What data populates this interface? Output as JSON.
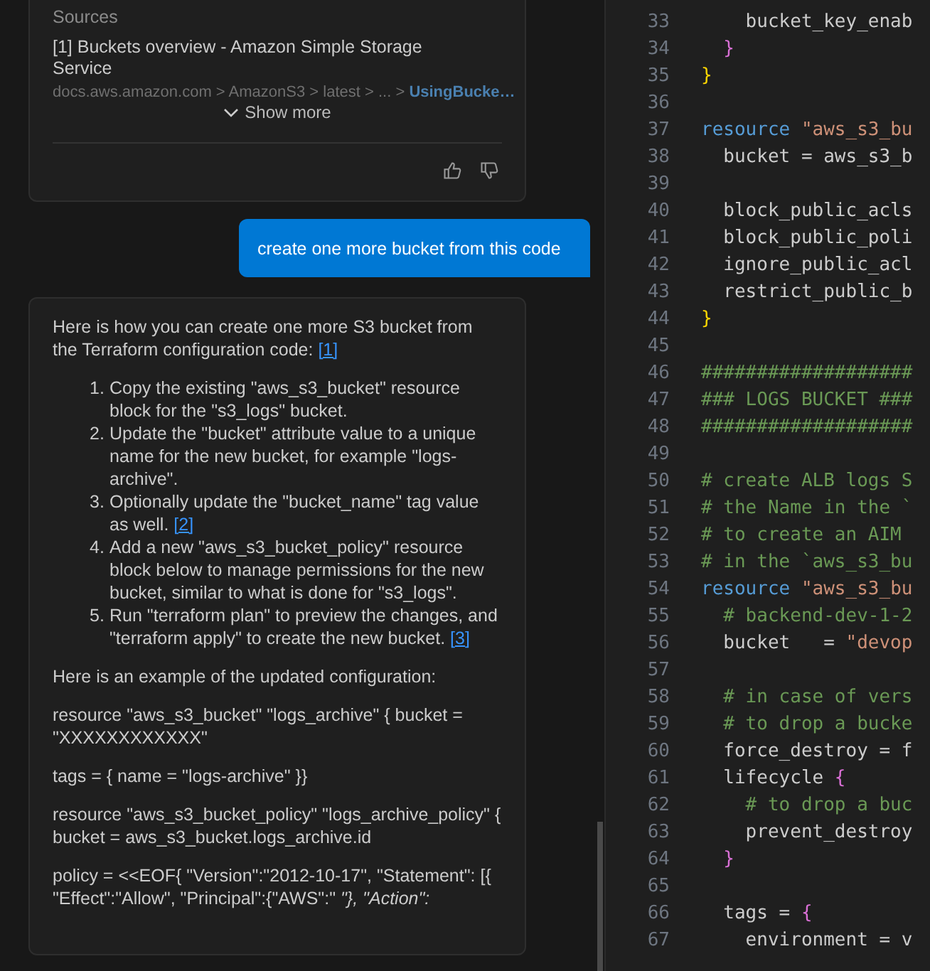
{
  "chat": {
    "sources_card": {
      "heading": "Sources",
      "source_title": "[1] Buckets overview - Amazon Simple Storage Service",
      "source_path": "docs.aws.amazon.com > AmazonS3 > latest > ... > ",
      "source_page": "UsingBucke…",
      "show_more": "Show more"
    },
    "user_message": "create one more bucket from this code",
    "answer": {
      "intro": {
        "text": "Here is how you can create one more S3 bucket from the Terraform configuration code: ",
        "ref": "[1]"
      },
      "steps": [
        {
          "number": "1.",
          "text": "Copy the existing \"aws_s3_bucket\" resource block for the \"s3_logs\" bucket."
        },
        {
          "number": "2.",
          "text": "Update the \"bucket\" attribute value to a unique name for the new bucket, for example \"logs-archive\"."
        },
        {
          "number": "3.",
          "text": "Optionally update the \"bucket_name\" tag value as well. ",
          "ref": "[2]"
        },
        {
          "number": "4.",
          "text": "Add a new \"aws_s3_bucket_policy\" resource block below to manage permissions for the new bucket, similar to what is done for \"s3_logs\"."
        },
        {
          "number": "5.",
          "text": "Run \"terraform plan\" to preview the changes, and \"terraform apply\" to create the new bucket. ",
          "ref": "[3]"
        }
      ],
      "paragraphs": [
        "Here is an example of the updated configuration:",
        "resource \"aws_s3_bucket\" \"logs_archive\" { bucket = \"XXXXXXXXXXXX\"",
        "tags = { name = \"logs-archive\" }}",
        "resource \"aws_s3_bucket_policy\" \"logs_archive_policy\" { bucket = aws_s3_bucket.logs_archive.id",
        "policy = <<EOF{ \"Version\":\"2012-10-17\", \"Statement\": [{ \"Effect\":\"Allow\", \"Principal\":{\"AWS\":\" *\"}, \"Action\":*"
      ]
    }
  },
  "editor": {
    "lines": [
      {
        "number": "33",
        "tokens": [
          {
            "kind": "plain",
            "text": "    bucket_key_enab"
          }
        ]
      },
      {
        "number": "34",
        "tokens": [
          {
            "kind": "brace2",
            "text": "  }"
          }
        ]
      },
      {
        "number": "35",
        "tokens": [
          {
            "kind": "brace1",
            "text": "}"
          }
        ]
      },
      {
        "number": "36"
      },
      {
        "number": "37",
        "tokens": [
          {
            "kind": "keyword",
            "text": "resource"
          },
          {
            "kind": "string",
            "text": " \"aws_s3_bu"
          }
        ]
      },
      {
        "number": "38",
        "tokens": [
          {
            "kind": "plain",
            "text": "  bucket = aws_s3_b"
          }
        ]
      },
      {
        "number": "39"
      },
      {
        "number": "40",
        "tokens": [
          {
            "kind": "plain",
            "text": "  block_public_acls"
          }
        ]
      },
      {
        "number": "41",
        "tokens": [
          {
            "kind": "plain",
            "text": "  block_public_poli"
          }
        ]
      },
      {
        "number": "42",
        "tokens": [
          {
            "kind": "plain",
            "text": "  ignore_public_acl"
          }
        ]
      },
      {
        "number": "43",
        "tokens": [
          {
            "kind": "plain",
            "text": "  restrict_public_b"
          }
        ]
      },
      {
        "number": "44",
        "tokens": [
          {
            "kind": "brace1",
            "text": "}"
          }
        ]
      },
      {
        "number": "45"
      },
      {
        "number": "46",
        "tokens": [
          {
            "kind": "comment",
            "text": "###################"
          }
        ]
      },
      {
        "number": "47",
        "tokens": [
          {
            "kind": "comment",
            "text": "### LOGS BUCKET ###"
          }
        ]
      },
      {
        "number": "48",
        "tokens": [
          {
            "kind": "comment",
            "text": "###################"
          }
        ]
      },
      {
        "number": "49"
      },
      {
        "number": "50",
        "tokens": [
          {
            "kind": "comment",
            "text": "# create ALB logs S"
          }
        ]
      },
      {
        "number": "51",
        "tokens": [
          {
            "kind": "comment",
            "text": "# the Name in the `"
          }
        ]
      },
      {
        "number": "52",
        "tokens": [
          {
            "kind": "comment",
            "text": "# to create an AIM"
          }
        ]
      },
      {
        "number": "53",
        "tokens": [
          {
            "kind": "comment",
            "text": "# in the `aws_s3_bu"
          }
        ]
      },
      {
        "number": "54",
        "tokens": [
          {
            "kind": "keyword",
            "text": "resource"
          },
          {
            "kind": "string",
            "text": " \"aws_s3_bu"
          }
        ]
      },
      {
        "number": "55",
        "tokens": [
          {
            "kind": "comment",
            "text": "  # backend-dev-1-2"
          }
        ]
      },
      {
        "number": "56",
        "tokens": [
          {
            "kind": "plain",
            "text": "  bucket   = "
          },
          {
            "kind": "string",
            "text": "\"devop"
          }
        ]
      },
      {
        "number": "57"
      },
      {
        "number": "58",
        "tokens": [
          {
            "kind": "comment",
            "text": "  # in case of vers"
          }
        ]
      },
      {
        "number": "59",
        "tokens": [
          {
            "kind": "comment",
            "text": "  # to drop a bucke"
          }
        ]
      },
      {
        "number": "60",
        "tokens": [
          {
            "kind": "plain",
            "text": "  force_destroy = f"
          }
        ]
      },
      {
        "number": "61",
        "tokens": [
          {
            "kind": "plain",
            "text": "  lifecycle "
          },
          {
            "kind": "brace2",
            "text": "{"
          }
        ]
      },
      {
        "number": "62",
        "tokens": [
          {
            "kind": "comment",
            "text": "    # to drop a buc"
          }
        ]
      },
      {
        "number": "63",
        "tokens": [
          {
            "kind": "plain",
            "text": "    prevent_destroy"
          }
        ]
      },
      {
        "number": "64",
        "tokens": [
          {
            "kind": "brace2",
            "text": "  }"
          }
        ]
      },
      {
        "number": "65"
      },
      {
        "number": "66",
        "tokens": [
          {
            "kind": "plain",
            "text": "  tags = "
          },
          {
            "kind": "brace2",
            "text": "{"
          }
        ]
      },
      {
        "number": "67",
        "tokens": [
          {
            "kind": "plain",
            "text": "    environment = v"
          }
        ]
      }
    ]
  }
}
